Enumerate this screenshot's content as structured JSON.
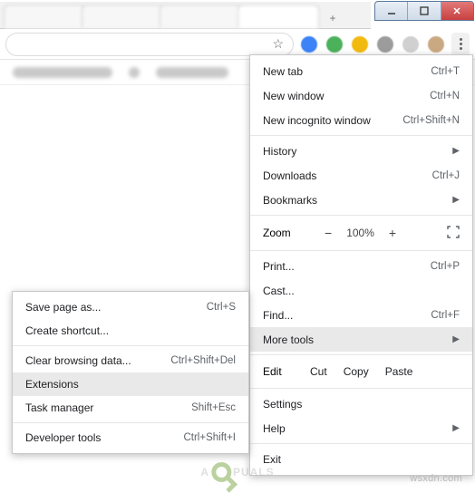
{
  "window": {
    "min": "_",
    "max": "☐",
    "close": "✕"
  },
  "tabs": {
    "new_tab_icon": "+"
  },
  "omnibox": {
    "star": "☆"
  },
  "menu": {
    "new_tab": {
      "label": "New tab",
      "shortcut": "Ctrl+T"
    },
    "new_window": {
      "label": "New window",
      "shortcut": "Ctrl+N"
    },
    "incognito": {
      "label": "New incognito window",
      "shortcut": "Ctrl+Shift+N"
    },
    "history": {
      "label": "History",
      "arrow": "▶"
    },
    "downloads": {
      "label": "Downloads",
      "shortcut": "Ctrl+J"
    },
    "bookmarks": {
      "label": "Bookmarks",
      "arrow": "▶"
    },
    "zoom": {
      "label": "Zoom",
      "minus": "−",
      "value": "100%",
      "plus": "+"
    },
    "print": {
      "label": "Print...",
      "shortcut": "Ctrl+P"
    },
    "cast": {
      "label": "Cast..."
    },
    "find": {
      "label": "Find...",
      "shortcut": "Ctrl+F"
    },
    "more_tools": {
      "label": "More tools",
      "arrow": "▶"
    },
    "edit": {
      "label": "Edit",
      "cut": "Cut",
      "copy": "Copy",
      "paste": "Paste"
    },
    "settings": {
      "label": "Settings"
    },
    "help": {
      "label": "Help",
      "arrow": "▶"
    },
    "exit": {
      "label": "Exit"
    }
  },
  "submenu": {
    "save_page": {
      "label": "Save page as...",
      "shortcut": "Ctrl+S"
    },
    "create_shortcut": {
      "label": "Create shortcut..."
    },
    "clear_data": {
      "label": "Clear browsing data...",
      "shortcut": "Ctrl+Shift+Del"
    },
    "extensions": {
      "label": "Extensions"
    },
    "task_manager": {
      "label": "Task manager",
      "shortcut": "Shift+Esc"
    },
    "dev_tools": {
      "label": "Developer tools",
      "shortcut": "Ctrl+Shift+I"
    }
  },
  "watermark": "wsxdn.com",
  "logo_text_left": "A",
  "logo_text_right": "PUALS",
  "colors": {
    "ext1": "#3c83f7",
    "ext2": "#4bb15a",
    "ext3": "#f2b90f",
    "ext4": "#9c9c9c",
    "ext5": "#d0d0d0",
    "avatar": "#c9a882"
  }
}
